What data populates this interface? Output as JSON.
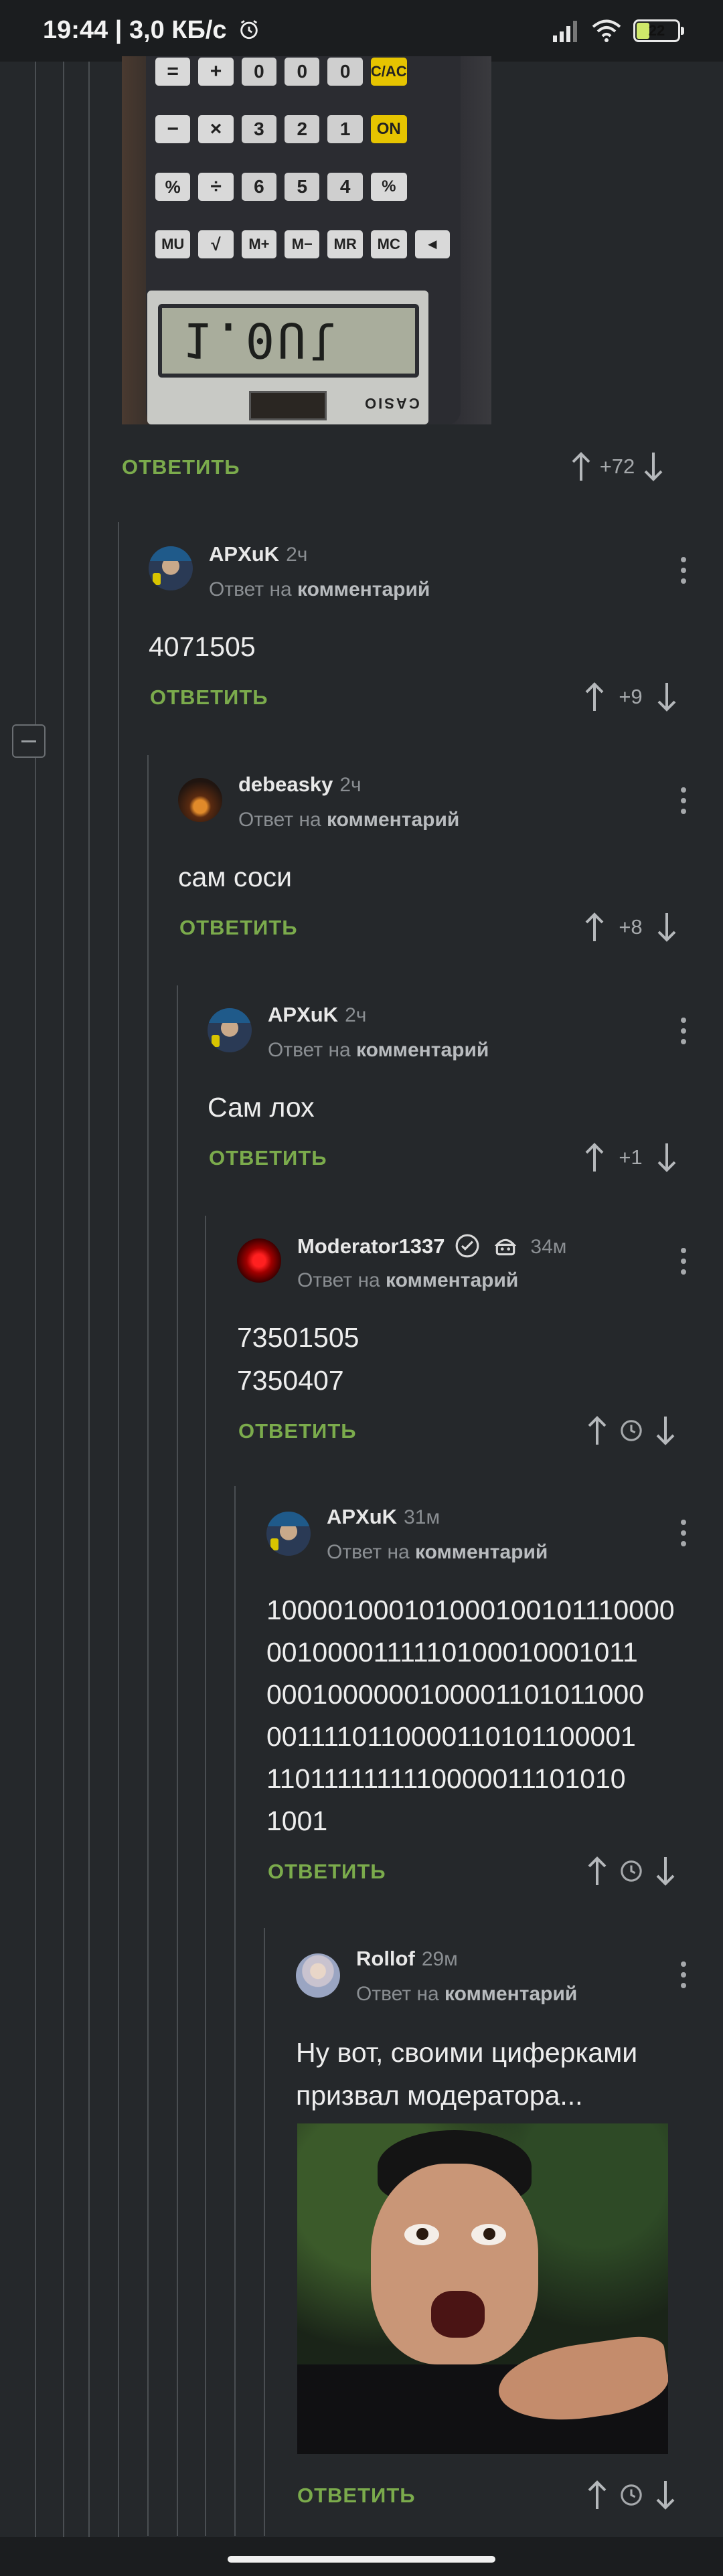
{
  "status_bar": {
    "time": "19:44",
    "speed": "3,0 КБ/с",
    "battery": "22"
  },
  "root_comment": {
    "reply_label": "ОТВЕТИТЬ",
    "score": "+72"
  },
  "comments": [
    {
      "author": "APXuK",
      "time": "2ч",
      "reply_prefix": "Ответ на",
      "reply_target": "комментарий",
      "text": "4071505",
      "reply_label": "ОТВЕТИТЬ",
      "score": "+9"
    },
    {
      "author": "debeasky",
      "time": "2ч",
      "reply_prefix": "Ответ на",
      "reply_target": "комментарий",
      "text": "сам соси",
      "reply_label": "ОТВЕТИТЬ",
      "score": "+8"
    },
    {
      "author": "APXuK",
      "time": "2ч",
      "reply_prefix": "Ответ на",
      "reply_target": "комментарий",
      "text": "Сам лох",
      "reply_label": "ОТВЕТИТЬ",
      "score": "+1"
    },
    {
      "author": "Moderator1337",
      "time": "34м",
      "reply_prefix": "Ответ на",
      "reply_target": "комментарий",
      "text": "73501505\n7350407",
      "reply_label": "ОТВЕТИТЬ"
    },
    {
      "author": "APXuK",
      "time": "31м",
      "reply_prefix": "Ответ на",
      "reply_target": "комментарий",
      "text": "100001000101000100101110000010000111110100010001011000100000010000110101100001111011000011010110000111011111111100000111010101001",
      "text_lines": [
        "100001000101000100101110000",
        "0010000111110100010001011",
        "0001000000100001101011000",
        "0011110110000110101100001",
        "1101111111110000011101010",
        "1001"
      ],
      "reply_label": "ОТВЕТИТЬ"
    },
    {
      "author": "Rollof",
      "time": "29м",
      "reply_prefix": "Ответ на",
      "reply_target": "комментарий",
      "text": "Ну вот, своими циферками\nпризвал модератора...",
      "reply_label": "ОТВЕТИТЬ"
    }
  ],
  "calculator": {
    "display": "1.0Ul",
    "brand": "CASIO",
    "keys": [
      "=",
      "+",
      "−",
      "×",
      "%",
      "÷",
      "MU",
      "√",
      "M+",
      "M−",
      "MR",
      "MC",
      "ON",
      "C/AC",
      "◄"
    ]
  },
  "colors": {
    "background": "#25282b",
    "accent_green": "#7bab4c",
    "muted": "#8a8e92",
    "thread_line": "#4a4e52"
  }
}
